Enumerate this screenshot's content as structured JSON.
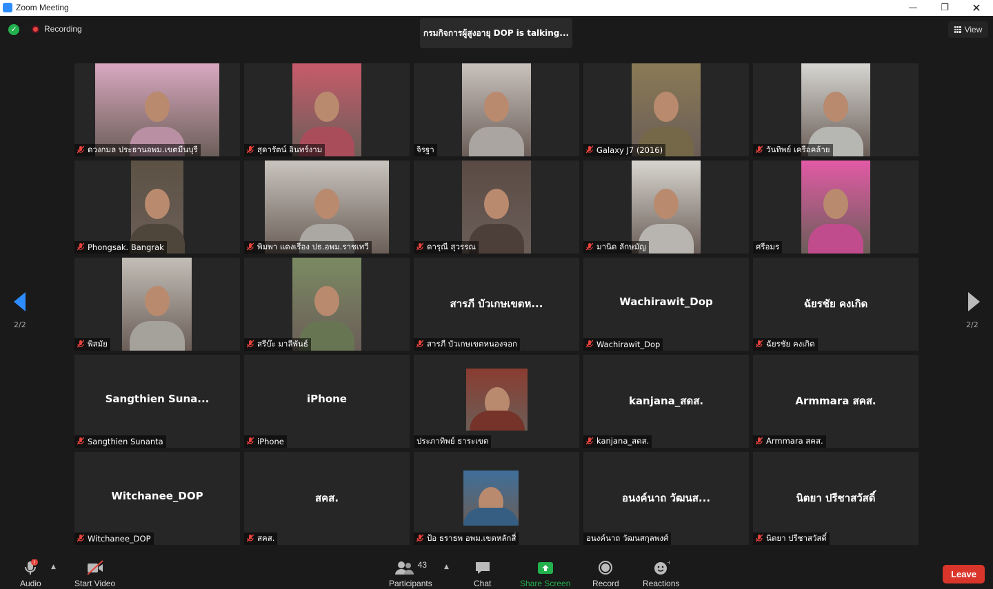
{
  "window": {
    "title": "Zoom Meeting"
  },
  "topbar": {
    "recording_label": "Recording",
    "talking_text": "กรมกิจการผู้สูงอายุ DOP is talking...",
    "view_label": "View"
  },
  "pager": {
    "prev_label": "2/2",
    "next_label": "2/2"
  },
  "tiles": [
    {
      "name": "ดวงกมล ประธานอพม.เขตมีนบุรี",
      "big": "",
      "muted": true,
      "video": true,
      "vc": "#d9a8c0"
    },
    {
      "name": "สุดารัตน์ อินทร์งาม",
      "big": "",
      "muted": true,
      "video": true,
      "vc": "#c85b6b"
    },
    {
      "name": "จิรฐา",
      "big": "",
      "muted": false,
      "video": true,
      "vc": "#c9c2bd"
    },
    {
      "name": "Galaxy J7 (2016)",
      "big": "",
      "muted": true,
      "video": true,
      "vc": "#8a7a55"
    },
    {
      "name": "วันทิพย์ เครือคล้าย",
      "big": "",
      "muted": true,
      "video": true,
      "vc": "#d6d6d2"
    },
    {
      "name": "Phongsak. Bangrak",
      "big": "",
      "muted": true,
      "video": true,
      "vc": "#5c5244"
    },
    {
      "name": "พิมพา แดงเรือง ปธ.อพม.ราชเทวี",
      "big": "",
      "muted": true,
      "video": true,
      "vc": "#c9c4be"
    },
    {
      "name": "ดารุณี สุวรรณ",
      "big": "",
      "muted": true,
      "video": true,
      "vc": "#5a4a44"
    },
    {
      "name": "มานิด ลักษมัญ",
      "big": "",
      "muted": true,
      "video": true,
      "vc": "#d8d5cf"
    },
    {
      "name": "ศรีอมร",
      "big": "",
      "muted": false,
      "video": true,
      "vc": "#e25aa6"
    },
    {
      "name": "พิสมัย",
      "big": "",
      "muted": true,
      "video": true,
      "vc": "#c2bdb6"
    },
    {
      "name": "สรีบ๊ะ   มาลีพันธ์",
      "big": "",
      "muted": true,
      "video": true,
      "vc": "#7a8a62"
    },
    {
      "name": "สารภี บัวเกษเขตหนองจอก",
      "big": "สารภี บัวเกษเขตห...",
      "muted": true,
      "video": false,
      "vc": ""
    },
    {
      "name": "Wachirawit_Dop",
      "big": "Wachirawit_Dop",
      "muted": true,
      "video": false,
      "vc": ""
    },
    {
      "name": "ฉัยรชัย คงเกิด",
      "big": "ฉัยรชัย คงเกิด",
      "muted": true,
      "video": false,
      "vc": ""
    },
    {
      "name": "Sangthien Sunanta",
      "big": "Sangthien  Suna...",
      "muted": true,
      "video": false,
      "vc": ""
    },
    {
      "name": "iPhone",
      "big": "iPhone",
      "muted": true,
      "video": false,
      "vc": ""
    },
    {
      "name": "ประภาทิพย์ ธาระเขต",
      "big": "",
      "muted": false,
      "video": true,
      "vc": "#8a3c30"
    },
    {
      "name": "kanjana_สดส.",
      "big": "kanjana_สดส.",
      "muted": true,
      "video": false,
      "vc": ""
    },
    {
      "name": "Armmara สคส.",
      "big": "Armmara สคส.",
      "muted": true,
      "video": false,
      "vc": ""
    },
    {
      "name": "Witchanee_DOP",
      "big": "Witchanee_DOP",
      "muted": true,
      "video": false,
      "vc": ""
    },
    {
      "name": "สคส.",
      "big": "สคส.",
      "muted": true,
      "video": false,
      "vc": ""
    },
    {
      "name": "ป้อ ธราธพ อพม.เขตหลักสี่",
      "big": "",
      "muted": true,
      "video": true,
      "vc": "#3f6f9a"
    },
    {
      "name": "อนงค์นาถ  วัฒนสกุลพงศ์",
      "big": "อนงค์นาถ  วัฒนส...",
      "muted": false,
      "video": false,
      "vc": ""
    },
    {
      "name": "นิตยา ปรีชาสวัสดิ์",
      "big": "นิตยา ปรีชาสวัสดิ์",
      "muted": true,
      "video": false,
      "vc": ""
    }
  ],
  "toolbar": {
    "audio_label": "Audio",
    "video_label": "Start Video",
    "participants_label": "Participants",
    "participants_count": "43",
    "chat_label": "Chat",
    "share_label": "Share Screen",
    "record_label": "Record",
    "reactions_label": "Reactions",
    "leave_label": "Leave"
  },
  "colors": {
    "accent": "#2d8cff",
    "share": "#23b14d",
    "leave": "#d9352b",
    "muted": "#e8423c"
  }
}
